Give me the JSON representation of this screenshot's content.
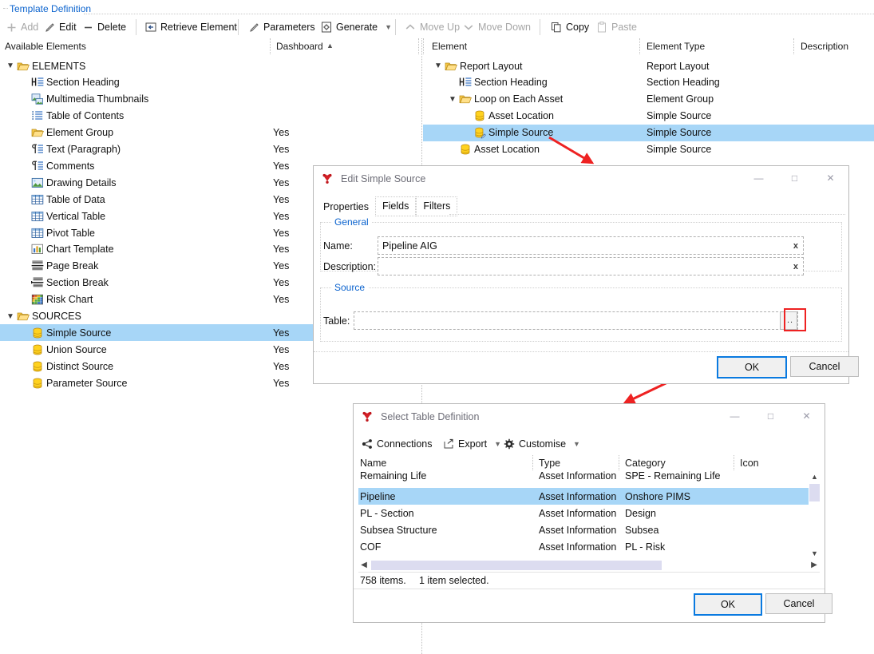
{
  "window": {
    "group_caption": "Template Definition"
  },
  "toolbar": {
    "items": [
      {
        "label": "Add",
        "icon": "plus-icon",
        "disabled": true,
        "caret": false
      },
      {
        "label": "Edit",
        "icon": "pencil-icon",
        "disabled": false,
        "caret": false
      },
      {
        "label": "Delete",
        "icon": "minus-icon",
        "disabled": false,
        "caret": false
      },
      {
        "label": "Retrieve Element",
        "icon": "retrieve-icon",
        "disabled": false,
        "caret": false
      },
      {
        "label": "Parameters",
        "icon": "pencil-icon",
        "disabled": false,
        "caret": false
      },
      {
        "label": "Generate",
        "icon": "gear-document-icon",
        "disabled": false,
        "caret": true
      },
      {
        "label": "Move Up",
        "icon": "chevron-up-icon",
        "disabled": true,
        "caret": false
      },
      {
        "label": "Move Down",
        "icon": "chevron-down-icon",
        "disabled": true,
        "caret": false
      },
      {
        "label": "Copy",
        "icon": "copy-icon",
        "disabled": false,
        "caret": false
      },
      {
        "label": "Paste",
        "icon": "paste-icon",
        "disabled": true,
        "caret": false
      }
    ]
  },
  "left_panel": {
    "headers": {
      "name": "Available Elements",
      "dashboard": "Dashboard",
      "dashboard_sort": "ascending"
    },
    "rows": [
      {
        "label": "ELEMENTS",
        "level": 0,
        "icon": "folder-open-icon",
        "twisty": "expanded",
        "dashboard": "",
        "selected": false
      },
      {
        "label": "Section Heading",
        "level": 1,
        "icon": "heading-icon",
        "twisty": "",
        "dashboard": "",
        "selected": false
      },
      {
        "label": "Multimedia Thumbnails",
        "level": 1,
        "icon": "multimedia-icon",
        "twisty": "",
        "dashboard": "",
        "selected": false
      },
      {
        "label": "Table of Contents",
        "level": 1,
        "icon": "toc-icon",
        "twisty": "",
        "dashboard": "",
        "selected": false
      },
      {
        "label": "Element Group",
        "level": 1,
        "icon": "folder-open-icon",
        "twisty": "",
        "dashboard": "Yes",
        "selected": false
      },
      {
        "label": "Text (Paragraph)",
        "level": 1,
        "icon": "paragraph-icon",
        "twisty": "",
        "dashboard": "Yes",
        "selected": false
      },
      {
        "label": "Comments",
        "level": 1,
        "icon": "paragraph-icon",
        "twisty": "",
        "dashboard": "Yes",
        "selected": false
      },
      {
        "label": "Drawing Details",
        "level": 1,
        "icon": "image-icon",
        "twisty": "",
        "dashboard": "Yes",
        "selected": false
      },
      {
        "label": "Table of Data",
        "level": 1,
        "icon": "grid-table-icon",
        "twisty": "",
        "dashboard": "Yes",
        "selected": false
      },
      {
        "label": "Vertical Table",
        "level": 1,
        "icon": "grid-table-icon",
        "twisty": "",
        "dashboard": "Yes",
        "selected": false
      },
      {
        "label": "Pivot Table",
        "level": 1,
        "icon": "grid-table-icon",
        "twisty": "",
        "dashboard": "Yes",
        "selected": false
      },
      {
        "label": "Chart Template",
        "level": 1,
        "icon": "bar-chart-icon",
        "twisty": "",
        "dashboard": "Yes",
        "selected": false
      },
      {
        "label": "Page Break",
        "level": 1,
        "icon": "page-break-icon",
        "twisty": "",
        "dashboard": "Yes",
        "selected": false
      },
      {
        "label": "Section Break",
        "level": 1,
        "icon": "section-break-icon",
        "twisty": "",
        "dashboard": "Yes",
        "selected": false
      },
      {
        "label": "Risk Chart",
        "level": 1,
        "icon": "risk-matrix-icon",
        "twisty": "",
        "dashboard": "Yes",
        "selected": false
      },
      {
        "label": "SOURCES",
        "level": 0,
        "icon": "folder-open-icon",
        "twisty": "expanded",
        "dashboard": "",
        "selected": false
      },
      {
        "label": "Simple Source",
        "level": 1,
        "icon": "database-icon",
        "twisty": "",
        "dashboard": "Yes",
        "selected": true
      },
      {
        "label": "Union Source",
        "level": 1,
        "icon": "database-icon",
        "twisty": "",
        "dashboard": "Yes",
        "selected": false
      },
      {
        "label": "Distinct Source",
        "level": 1,
        "icon": "database-icon",
        "twisty": "",
        "dashboard": "Yes",
        "selected": false
      },
      {
        "label": "Parameter Source",
        "level": 1,
        "icon": "database-icon",
        "twisty": "",
        "dashboard": "Yes",
        "selected": false
      }
    ]
  },
  "right_panel": {
    "headers": {
      "element": "Element",
      "element_type": "Element Type",
      "description": "Description"
    },
    "rows": [
      {
        "label": "Report Layout",
        "level": 0,
        "icon": "folder-open-icon",
        "twisty": "expanded",
        "type": "Report Layout",
        "description": "",
        "selected": false
      },
      {
        "label": "Section Heading",
        "level": 1,
        "icon": "heading-icon",
        "twisty": "",
        "type": "Section Heading",
        "description": "",
        "selected": false
      },
      {
        "label": "Loop on Each Asset",
        "level": 1,
        "icon": "folder-open-icon",
        "twisty": "expanded",
        "type": "Element Group",
        "description": "",
        "selected": false
      },
      {
        "label": "Asset Location",
        "level": 2,
        "icon": "database-icon",
        "twisty": "",
        "type": "Simple Source",
        "description": "",
        "selected": false
      },
      {
        "label": "Simple Source",
        "level": 2,
        "icon": "database-edit-icon",
        "twisty": "",
        "type": "Simple Source",
        "description": "",
        "selected": true
      },
      {
        "label": "Asset Location",
        "level": 1,
        "icon": "database-icon",
        "twisty": "",
        "type": "Simple Source",
        "description": "",
        "selected": false
      }
    ]
  },
  "edit_dialog": {
    "title": "Edit Simple Source",
    "app_icon": "app-logo-icon",
    "window_buttons": {
      "minimize": "—",
      "maximize": "□",
      "close": "✕"
    },
    "tabs": [
      {
        "label": "Properties",
        "active": true
      },
      {
        "label": "Fields",
        "active": false
      },
      {
        "label": "Filters",
        "active": false
      }
    ],
    "general_group": "General",
    "fields": [
      {
        "label": "Name:",
        "value": "Pipeline AIG",
        "clear": "x"
      },
      {
        "label": "Description:",
        "value": "",
        "clear": "x"
      }
    ],
    "source_group": "Source",
    "table_field": {
      "label": "Table:",
      "value": "",
      "browse_button": "..."
    },
    "ok_label": "OK",
    "cancel_label": "Cancel"
  },
  "select_dialog": {
    "title": "Select Table Definition",
    "app_icon": "app-logo-icon",
    "window_buttons": {
      "minimize": "—",
      "maximize": "□",
      "close": "✕"
    },
    "toolbar": [
      {
        "label": "Connections",
        "icon": "share-nodes-icon",
        "caret": false
      },
      {
        "label": "Export",
        "icon": "export-icon",
        "caret": true
      },
      {
        "label": "Customise",
        "icon": "gear-icon",
        "caret": true
      }
    ],
    "columns": [
      {
        "label": "Name",
        "sort": ""
      },
      {
        "label": "Type",
        "sort": "ascending"
      },
      {
        "label": "Category",
        "sort": ""
      },
      {
        "label": "Icon",
        "sort": ""
      }
    ],
    "rows": [
      {
        "name": "Remaining Life",
        "type": "Asset Information",
        "category": "SPE - Remaining Life",
        "icon": "",
        "selected": false,
        "clipped": true
      },
      {
        "name": "Pipeline",
        "type": "Asset Information",
        "category": "Onshore PIMS",
        "icon": "",
        "selected": true
      },
      {
        "name": "PL - Section",
        "type": "Asset Information",
        "category": "Design",
        "icon": "",
        "selected": false
      },
      {
        "name": "Subsea Structure",
        "type": "Asset Information",
        "category": "Subsea",
        "icon": "",
        "selected": false
      },
      {
        "name": "COF",
        "type": "Asset Information",
        "category": "PL - Risk",
        "icon": "",
        "selected": false
      }
    ],
    "status": {
      "items": "758 items.",
      "selection": "1 item selected."
    },
    "ok_label": "OK",
    "cancel_label": "Cancel"
  },
  "annotations": {
    "arrow_color": "#ee2222",
    "highlight_color": "#ee2222",
    "arrow_1": "points from selected Simple Source row down to Edit dialog",
    "arrow_2": "points from the browse (...) button down to Select Table Definition dialog"
  },
  "colors": {
    "selection_blue": "#a7d6f7",
    "link_blue": "#0b63ce",
    "accent_blue": "#0a7ae0",
    "folder_yellow": "#ffd966",
    "database_yellow": "#f5d020"
  }
}
